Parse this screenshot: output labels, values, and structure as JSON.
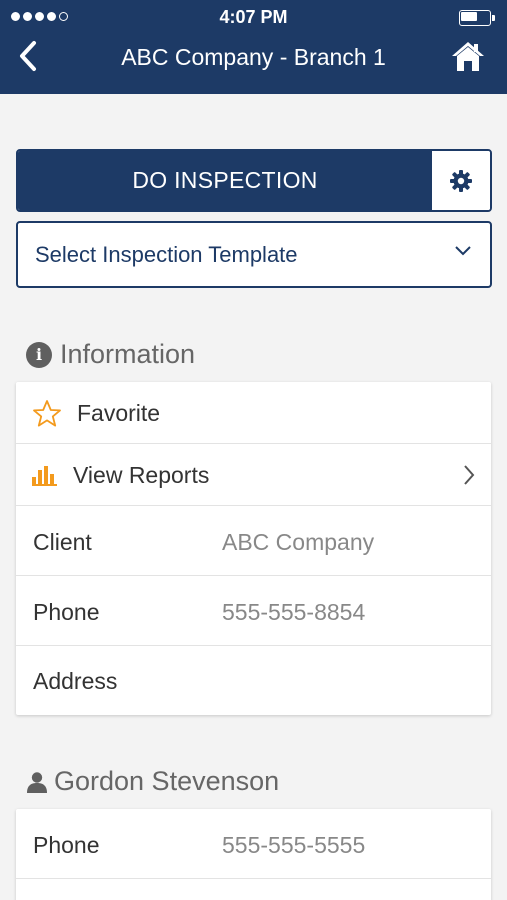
{
  "status_bar": {
    "time": "4:07 PM"
  },
  "nav": {
    "title": "ABC Company - Branch 1",
    "back_icon": "chevron-left-icon",
    "home_icon": "home-icon"
  },
  "inspection": {
    "button_label": "DO INSPECTION",
    "settings_icon": "gear-icon"
  },
  "template_select": {
    "selected": "Select Inspection Template"
  },
  "information": {
    "heading": "Information",
    "favorite_label": "Favorite",
    "view_reports_label": "View Reports",
    "fields": [
      {
        "label": "Client",
        "value": "ABC Company"
      },
      {
        "label": "Phone",
        "value": "555-555-8854"
      },
      {
        "label": "Address",
        "value": ""
      }
    ]
  },
  "contact": {
    "name": "Gordon Stevenson",
    "fields": [
      {
        "label": "Phone",
        "value": "555-555-5555"
      }
    ]
  },
  "colors": {
    "primary": "#1d3a66",
    "accent": "#f39a1d",
    "background": "#f3f3f3"
  }
}
